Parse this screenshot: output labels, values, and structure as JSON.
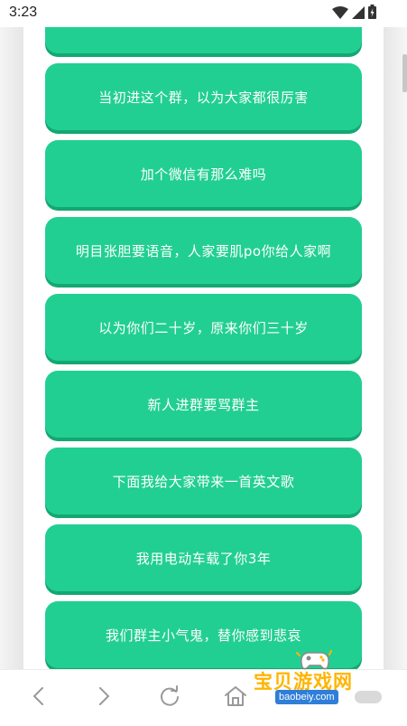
{
  "status_bar": {
    "time": "3:23",
    "icons": [
      "wifi-icon",
      "signal-icon",
      "battery-icon"
    ]
  },
  "phrases": [
    "",
    "当初进这个群，以为大家都很厉害",
    "加个微信有那么难吗",
    "明目张胆要语音，人家要肌po你给人家啊",
    "以为你们二十岁，原来你们三十岁",
    "新人进群要骂群主",
    "下面我给大家带来一首英文歌",
    "我用电动车载了你3年",
    "我们群主小气鬼，替你感到悲哀",
    ""
  ],
  "colors": {
    "button": "#22cf92",
    "button_shadow": "#13a872",
    "button_text": "#ffffff"
  },
  "nav": {
    "icons": [
      "back-icon",
      "forward-icon",
      "refresh-icon",
      "home-icon"
    ]
  },
  "watermark": {
    "title": "宝贝游戏网",
    "url": "baobeiy.com"
  }
}
